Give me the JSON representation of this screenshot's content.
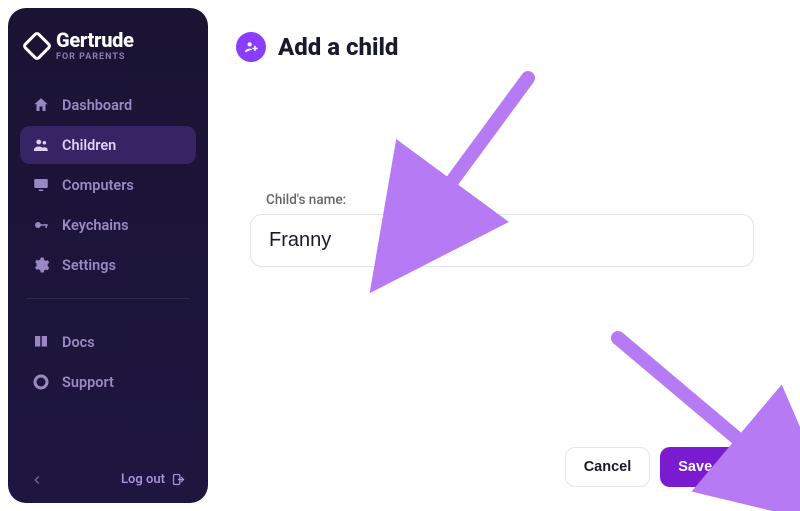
{
  "brand": {
    "name": "Gertrude",
    "sub": "FOR PARENTS"
  },
  "sidebar": {
    "items": [
      {
        "label": "Dashboard"
      },
      {
        "label": "Children"
      },
      {
        "label": "Computers"
      },
      {
        "label": "Keychains"
      },
      {
        "label": "Settings"
      }
    ],
    "secondary": [
      {
        "label": "Docs"
      },
      {
        "label": "Support"
      }
    ],
    "logout_label": "Log out"
  },
  "page": {
    "title": "Add a child",
    "field_label": "Child's name:",
    "name_value": "Franny",
    "cancel_label": "Cancel",
    "save_label": "Save child"
  }
}
